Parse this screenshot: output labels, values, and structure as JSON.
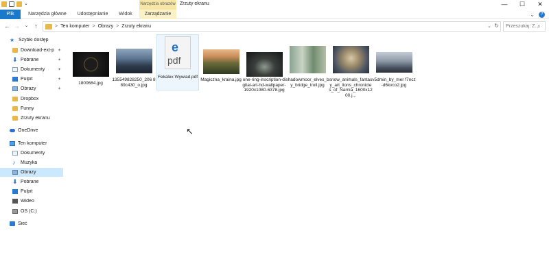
{
  "window": {
    "contextual_tools_label": "Narzędzia obrazów",
    "title": "Zrzuty ekranu",
    "minimize": "—",
    "maximize": "☐",
    "close": "✕"
  },
  "ribbon": {
    "tabs": [
      "Plik",
      "Narzędzia główne",
      "Udostępnianie",
      "Widok",
      "Zarządzanie"
    ],
    "expand": "⌄",
    "help": "?"
  },
  "navigation": {
    "back": "←",
    "forward": "→",
    "recent": "⌄",
    "up": "↑",
    "breadcrumb": [
      "Ten komputer",
      "Obrazy",
      "Zrzuty ekranu"
    ],
    "separator": ">",
    "dropdown": "⌄",
    "refresh": "↻",
    "search_placeholder": "Przeszukaj: Z...",
    "search_icon": "⌕"
  },
  "sidebar": {
    "items": [
      {
        "label": "Szybki dostęp",
        "icon": "star-icon",
        "pinned": false
      },
      {
        "label": "Download-ext-p",
        "icon": "folder-icon",
        "pinned": true
      },
      {
        "label": "Pobrane",
        "icon": "download-icon",
        "pinned": true
      },
      {
        "label": "Dokumenty",
        "icon": "documents-icon",
        "pinned": true
      },
      {
        "label": "Pulpit",
        "icon": "desktop-icon",
        "pinned": true
      },
      {
        "label": "Obrazy",
        "icon": "pictures-icon",
        "pinned": true
      },
      {
        "label": "Dropbox",
        "icon": "folder-icon",
        "pinned": false
      },
      {
        "label": "Funny",
        "icon": "folder-icon",
        "pinned": false
      },
      {
        "label": "Zrzuty ekranu",
        "icon": "folder-icon",
        "pinned": false
      },
      {
        "label": "OneDrive",
        "icon": "cloud-icon",
        "pinned": false
      },
      {
        "label": "Ten komputer",
        "icon": "computer-icon",
        "pinned": false
      },
      {
        "label": "Dokumenty",
        "icon": "documents-icon",
        "pinned": false
      },
      {
        "label": "Muzyka",
        "icon": "music-icon",
        "pinned": false
      },
      {
        "label": "Obrazy",
        "icon": "pictures-icon",
        "pinned": false,
        "selected": true
      },
      {
        "label": "Pobrane",
        "icon": "download-icon",
        "pinned": false
      },
      {
        "label": "Pulpit",
        "icon": "desktop-icon",
        "pinned": false
      },
      {
        "label": "Wideo",
        "icon": "video-icon",
        "pinned": false
      },
      {
        "label": "OS (C:)",
        "icon": "drive-icon",
        "pinned": false
      },
      {
        "label": "Sieć",
        "icon": "network-icon",
        "pinned": false
      }
    ],
    "pin_glyph": "✦"
  },
  "files": [
    {
      "name": "1800684.jpg"
    },
    {
      "name": "135549828250_206 889c430_o.jpg"
    },
    {
      "name": "Fekalex Wywiad.pdf",
      "type": "pdf",
      "thumb_e": "e",
      "thumb_text": "pdf"
    },
    {
      "name": "Magiczna_kraina.jpg"
    },
    {
      "name": "one-ring-inscription-digital-art-hd-wallpaper-1920x1080-6378.jpg"
    },
    {
      "name": "shadowmoor_elves_by_bridge_troll.jpg"
    },
    {
      "name": "snow_animals_fantasy_art_lions_chronicles_of_Narnia_1600x1200.j..."
    },
    {
      "name": "v5dmin_by_mer f7ncz-d6kvco2.jpg"
    }
  ]
}
